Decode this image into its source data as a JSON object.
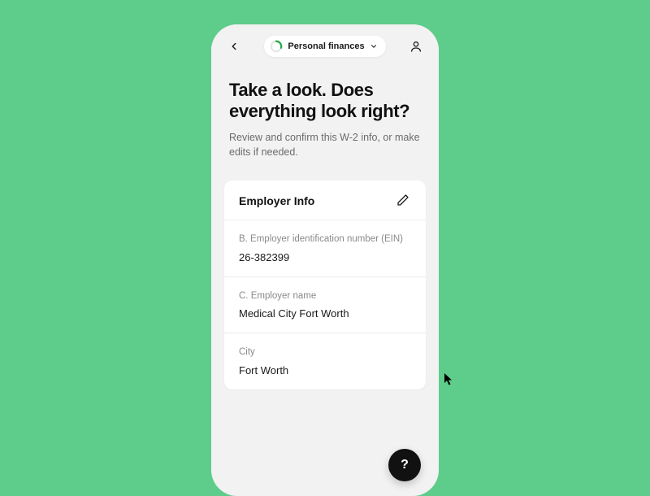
{
  "header": {
    "chip_label": "Personal finances"
  },
  "page": {
    "title": "Take a look. Does everything look right?",
    "subtitle": "Review and confirm this W-2 info, or make edits if needed."
  },
  "card": {
    "title": "Employer Info",
    "fields": [
      {
        "label": "B. Employer identification number (EIN)",
        "value": "26-382399"
      },
      {
        "label": "C. Employer name",
        "value": "Medical City Fort Worth"
      },
      {
        "label": "City",
        "value": "Fort Worth"
      }
    ]
  },
  "help": {
    "label": "?"
  },
  "colors": {
    "background": "#5ecc8a",
    "accent": "#28a745"
  }
}
